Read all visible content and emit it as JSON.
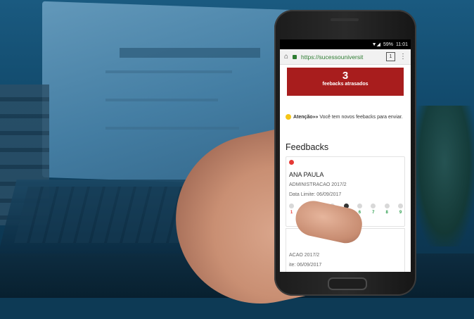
{
  "status_bar": {
    "battery": "59%",
    "time": "11:01"
  },
  "browser": {
    "url": "https://sucessouniversit",
    "tab_count": "1"
  },
  "banner": {
    "count": "3",
    "label": "feebacks atrasados"
  },
  "alert": {
    "title": "Atenção»»",
    "message": " Você tem novos feebacks para enviar."
  },
  "section_title": "Feedbacks",
  "feedbacks": [
    {
      "name": "ANA PAULA",
      "course": "ADMINISTRACAO 2017/2",
      "deadline": "Data Limite: 06/09/2017",
      "scale": [
        "1",
        "2",
        "3",
        "4",
        "5",
        "6",
        "7",
        "8",
        "9"
      ]
    },
    {
      "course": "ACAO 2017/2",
      "deadline": "ite: 06/09/2017"
    }
  ],
  "colors": {
    "banner": "#a81d1d",
    "alert_dot": "#e53935",
    "scale_high": "#2e9e4f",
    "scale_low": "#e53935"
  }
}
